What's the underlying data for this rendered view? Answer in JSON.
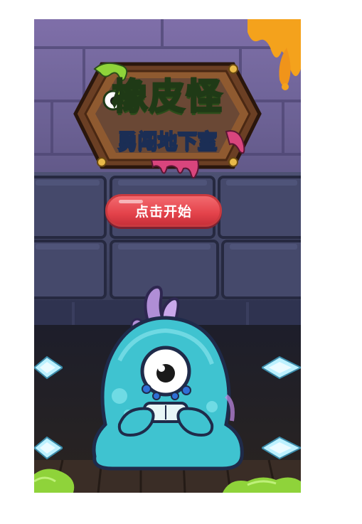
{
  "game": {
    "title_main": "橡皮怪",
    "title_sub": "勇闯地下室",
    "start_button_label": "点击开始"
  },
  "icons": {
    "logo": "game-logo",
    "monster": "crying-cyclops-slime",
    "crystals": "ice-crystal"
  },
  "colors": {
    "wall": "#4a4e74",
    "start_button": "#e4434b",
    "slime_green": "#8fd33a",
    "monster_body": "#3fc3d0"
  }
}
